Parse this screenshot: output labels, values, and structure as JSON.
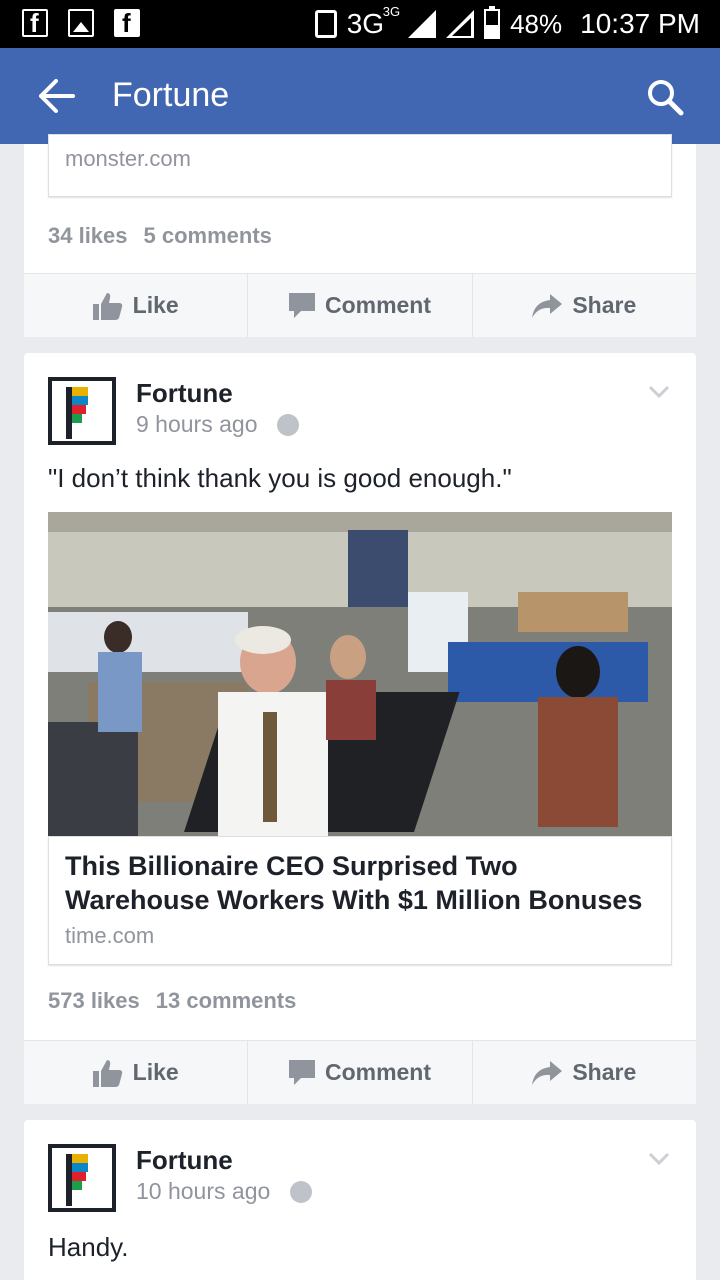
{
  "status_bar": {
    "network": "3G",
    "network_sup": "3G",
    "battery": "48%",
    "time": "10:37 PM"
  },
  "app_bar": {
    "title": "Fortune"
  },
  "post1": {
    "link_source": "monster.com",
    "likes": "34 likes",
    "comments": "5 comments"
  },
  "actions": {
    "like": "Like",
    "comment": "Comment",
    "share": "Share"
  },
  "post2": {
    "page_name": "Fortune",
    "time": "9 hours ago",
    "text": "\"I don’t think thank you is good enough.\"",
    "link_title": "This Billionaire CEO Surprised Two Warehouse Workers With $1 Million Bonuses",
    "link_source": "time.com",
    "likes": "573 likes",
    "comments": "13 comments"
  },
  "post3": {
    "page_name": "Fortune",
    "time": "10 hours ago",
    "text": "Handy."
  },
  "colors": {
    "brand_blue": "#4267b2",
    "muted_text": "#90949c",
    "background": "#e9ebee"
  },
  "icons": [
    "facebook-icon",
    "gallery-icon",
    "vibrate-icon",
    "signal-icon",
    "battery-icon",
    "back-arrow-icon",
    "search-icon",
    "thumbs-up-icon",
    "comment-icon",
    "share-icon",
    "globe-icon",
    "chevron-down-icon"
  ]
}
